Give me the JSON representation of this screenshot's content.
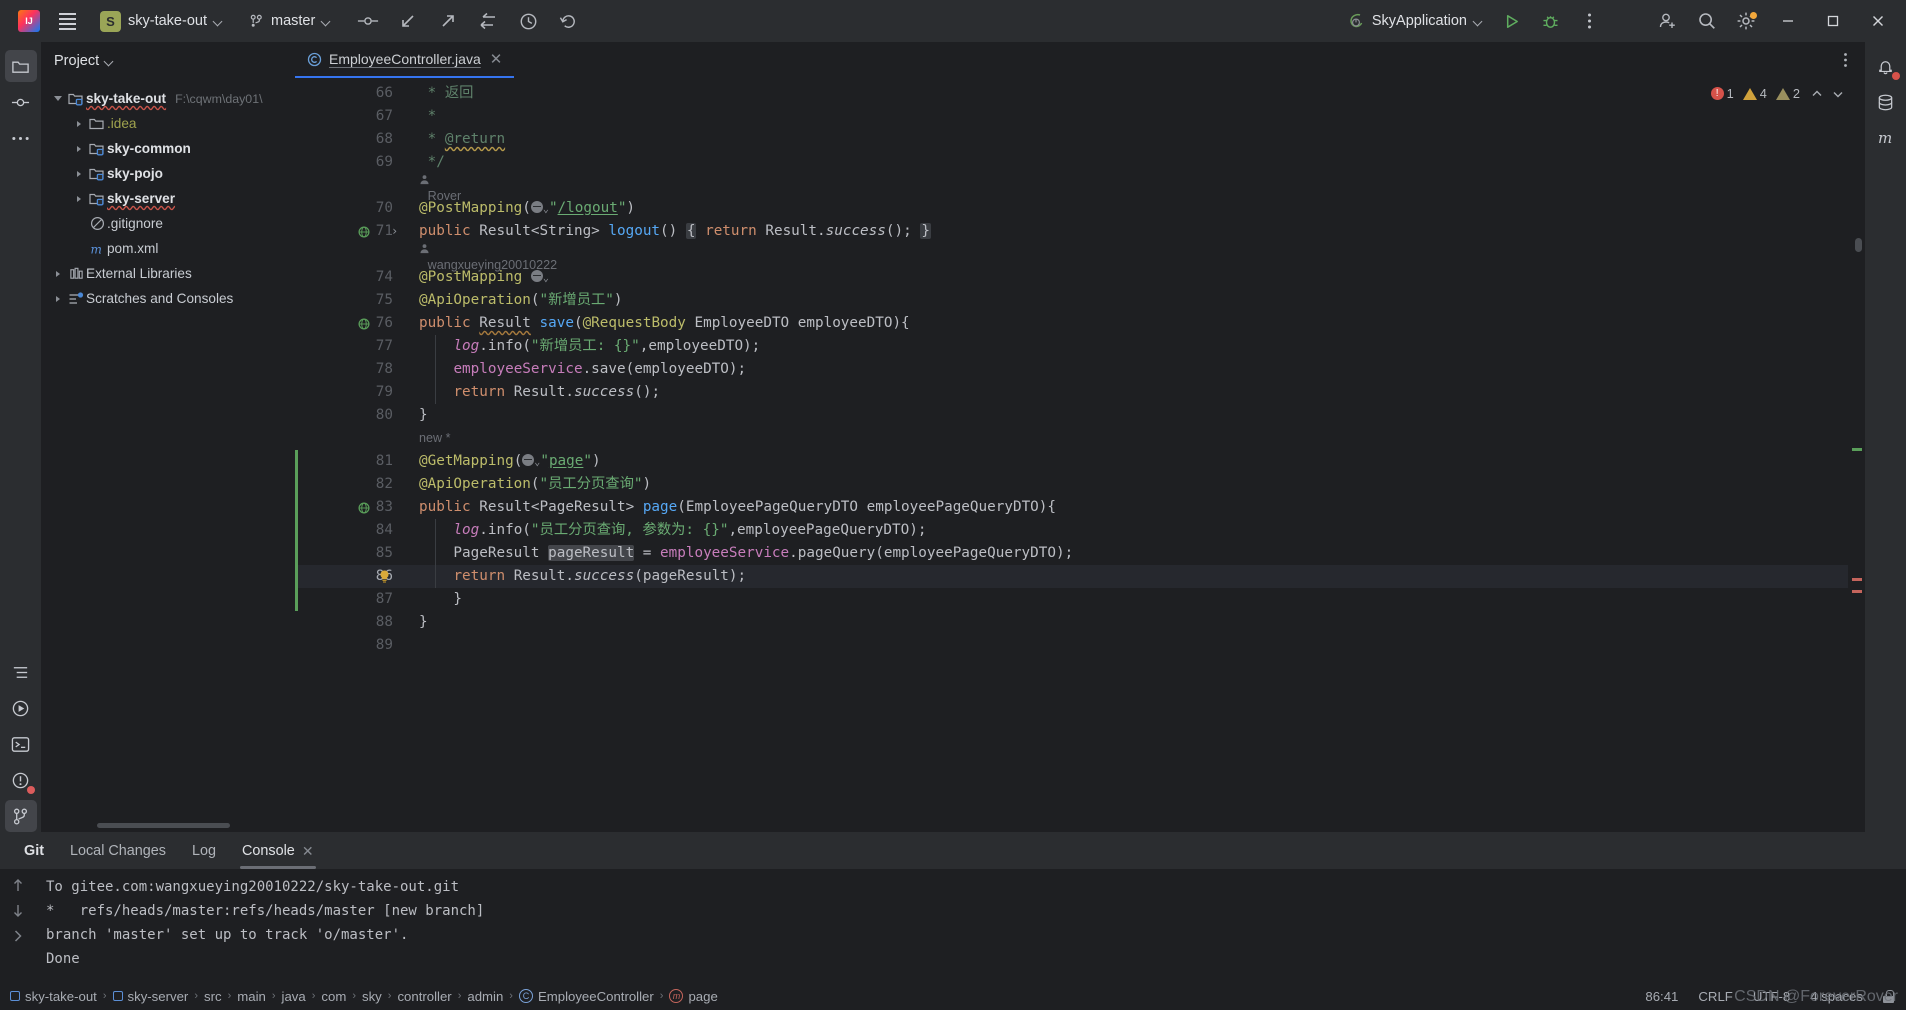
{
  "titlebar": {
    "project_name": "sky-take-out",
    "project_badge": "S",
    "branch": "master",
    "run_config": "SkyApplication",
    "icons": [
      "main-menu-icon",
      "vcs-commit-icon",
      "vcs-update-icon",
      "vcs-push-icon",
      "vcs-rollback-icon",
      "recent-files-icon",
      "undo-icon",
      "run-icon",
      "debug-icon",
      "more-actions-icon",
      "add-account-icon",
      "search-everywhere-icon",
      "settings-icon"
    ],
    "window_buttons": [
      "minimize",
      "maximize",
      "close"
    ]
  },
  "left_rail": {
    "items": [
      {
        "name": "project-tool-window",
        "icon": "folder-icon",
        "active": true
      },
      {
        "name": "commit-tool-window",
        "icon": "commit-icon",
        "active": false
      },
      {
        "name": "more-tool-windows",
        "icon": "ellipsis-icon",
        "active": false
      },
      {
        "name": "structure-tool-window",
        "icon": "structure-icon",
        "active": false
      },
      {
        "name": "services-tool-window",
        "icon": "services-icon",
        "active": false
      },
      {
        "name": "terminal-tool-window",
        "icon": "terminal-icon",
        "active": false
      },
      {
        "name": "problems-tool-window",
        "icon": "problems-icon",
        "active": false
      },
      {
        "name": "git-tool-window",
        "icon": "git-branch-icon",
        "active": true
      }
    ]
  },
  "right_rail": {
    "items": [
      {
        "name": "notifications-tool-window",
        "icon": "bell-icon"
      },
      {
        "name": "database-tool-window",
        "icon": "database-icon"
      },
      {
        "name": "maven-tool-window",
        "icon": "maven-icon"
      }
    ]
  },
  "project_panel": {
    "title": "Project",
    "tree": [
      {
        "indent": 0,
        "arrow": "open",
        "icon": "module-folder-icon",
        "label": "sky-take-out",
        "bold": true,
        "wavy": true,
        "note": "F:\\cqwm\\day01\\"
      },
      {
        "indent": 1,
        "arrow": "closed",
        "icon": "folder-icon",
        "label": ".idea",
        "bold": false,
        "olive": true
      },
      {
        "indent": 1,
        "arrow": "closed",
        "icon": "module-folder-icon",
        "label": "sky-common",
        "bold": true
      },
      {
        "indent": 1,
        "arrow": "closed",
        "icon": "module-folder-icon",
        "label": "sky-pojo",
        "bold": true
      },
      {
        "indent": 1,
        "arrow": "closed",
        "icon": "module-folder-icon",
        "label": "sky-server",
        "bold": true,
        "wavy": true
      },
      {
        "indent": 1,
        "arrow": "none",
        "icon": "gitignore-icon",
        "label": ".gitignore"
      },
      {
        "indent": 1,
        "arrow": "none",
        "icon": "maven-m-icon",
        "label": "pom.xml"
      },
      {
        "indent": 0,
        "arrow": "closed",
        "icon": "library-icon",
        "label": "External Libraries"
      },
      {
        "indent": 0,
        "arrow": "closed",
        "icon": "scratches-icon",
        "label": "Scratches and Consoles"
      }
    ]
  },
  "editor": {
    "tab": {
      "filename": "EmployeeController.java",
      "icon": "java-class-icon"
    },
    "inspections": {
      "errors": "1",
      "warnings": "4",
      "weak_warnings": "2"
    },
    "lines": [
      {
        "num": "66",
        "segments": [
          {
            "t": " * ",
            "c": "cmt"
          },
          {
            "t": "返回",
            "c": "cmt"
          }
        ]
      },
      {
        "num": "67",
        "segments": [
          {
            "t": " *",
            "c": "cmt"
          }
        ]
      },
      {
        "num": "68",
        "segments": [
          {
            "t": " * ",
            "c": "cmt"
          },
          {
            "t": "@return",
            "c": "cmt wavy-y"
          }
        ]
      },
      {
        "num": "69",
        "segments": [
          {
            "t": " */",
            "c": "cmt"
          }
        ]
      },
      {
        "num": "",
        "inlay": "Rover",
        "inlay_icon": "author-icon"
      },
      {
        "num": "70",
        "segments": [
          {
            "t": "@PostMapping",
            "c": "ann"
          },
          {
            "t": "(",
            "c": "pun"
          },
          {
            "t": "GLOBE"
          },
          {
            "t": "\"",
            "c": "str"
          },
          {
            "t": "/logout",
            "c": "str und"
          },
          {
            "t": "\"",
            "c": "str"
          },
          {
            "t": ")",
            "c": "pun"
          }
        ]
      },
      {
        "num": "71",
        "gutter_icon": "web-method-icon",
        "fold": true,
        "segments": [
          {
            "t": "public ",
            "c": "kw"
          },
          {
            "t": "Result",
            "c": "typ"
          },
          {
            "t": "<String> ",
            "c": "pun"
          },
          {
            "t": "logout",
            "c": "mth"
          },
          {
            "t": "() ",
            "c": "pun"
          },
          {
            "t": "{",
            "c": "folded-brace"
          },
          {
            "t": " ",
            "c": "pun"
          },
          {
            "t": "return ",
            "c": "kw"
          },
          {
            "t": "Result.",
            "c": "typ"
          },
          {
            "t": "success",
            "c": "stat"
          },
          {
            "t": "(); ",
            "c": "pun"
          },
          {
            "t": "}",
            "c": "folded-brace"
          }
        ]
      },
      {
        "num": "",
        "inlay": "wangxueying20010222",
        "inlay_icon": "author-icon"
      },
      {
        "num": "74",
        "segments": [
          {
            "t": "@PostMapping",
            "c": "ann"
          },
          {
            "t": " ",
            "c": "pun"
          },
          {
            "t": "GLOBE"
          }
        ]
      },
      {
        "num": "75",
        "segments": [
          {
            "t": "@ApiOperation",
            "c": "ann"
          },
          {
            "t": "(",
            "c": "pun"
          },
          {
            "t": "\"新增员工\"",
            "c": "str"
          },
          {
            "t": ")",
            "c": "pun"
          }
        ]
      },
      {
        "num": "76",
        "gutter_icon": "web-method-icon",
        "segments": [
          {
            "t": "public ",
            "c": "kw"
          },
          {
            "t": "Result",
            "c": "typ wavy-o"
          },
          {
            "t": " ",
            "c": "pun"
          },
          {
            "t": "save",
            "c": "mth"
          },
          {
            "t": "(",
            "c": "pun"
          },
          {
            "t": "@RequestBody",
            "c": "ann"
          },
          {
            "t": " EmployeeDTO employeeDTO){",
            "c": "pun"
          }
        ]
      },
      {
        "num": "77",
        "indent_guide": true,
        "segments": [
          {
            "t": "    ",
            "c": "pun"
          },
          {
            "t": "log",
            "c": "logv"
          },
          {
            "t": ".",
            "c": "pun"
          },
          {
            "t": "info",
            "c": "pun"
          },
          {
            "t": "(",
            "c": "pun"
          },
          {
            "t": "\"新增员工: {}\"",
            "c": "str"
          },
          {
            "t": ",employeeDTO);",
            "c": "pun"
          }
        ]
      },
      {
        "num": "78",
        "indent_guide": true,
        "segments": [
          {
            "t": "    ",
            "c": "pun"
          },
          {
            "t": "employeeService",
            "c": "fld"
          },
          {
            "t": ".save(employeeDTO);",
            "c": "pun"
          }
        ]
      },
      {
        "num": "79",
        "indent_guide": true,
        "segments": [
          {
            "t": "    ",
            "c": "pun"
          },
          {
            "t": "return ",
            "c": "kw"
          },
          {
            "t": "Result.",
            "c": "typ"
          },
          {
            "t": "success",
            "c": "stat"
          },
          {
            "t": "();",
            "c": "pun"
          }
        ]
      },
      {
        "num": "80",
        "segments": [
          {
            "t": "}",
            "c": "pun"
          }
        ]
      },
      {
        "num": "",
        "inlay": "new *"
      },
      {
        "num": "81",
        "changed": true,
        "segments": [
          {
            "t": "@GetMapping",
            "c": "ann"
          },
          {
            "t": "(",
            "c": "pun"
          },
          {
            "t": "GLOBE"
          },
          {
            "t": "\"",
            "c": "str"
          },
          {
            "t": "page",
            "c": "str und"
          },
          {
            "t": "\"",
            "c": "str"
          },
          {
            "t": ")",
            "c": "pun"
          }
        ]
      },
      {
        "num": "82",
        "changed": true,
        "segments": [
          {
            "t": "@ApiOperation",
            "c": "ann"
          },
          {
            "t": "(",
            "c": "pun"
          },
          {
            "t": "\"员工分页查询\"",
            "c": "str"
          },
          {
            "t": ")",
            "c": "pun"
          }
        ]
      },
      {
        "num": "83",
        "changed": true,
        "gutter_icon": "web-method-icon",
        "segments": [
          {
            "t": "public ",
            "c": "kw"
          },
          {
            "t": "Result",
            "c": "typ"
          },
          {
            "t": "<PageResult> ",
            "c": "pun"
          },
          {
            "t": "page",
            "c": "mth"
          },
          {
            "t": "(EmployeePageQueryDTO employeePageQueryDTO){",
            "c": "pun"
          }
        ]
      },
      {
        "num": "84",
        "changed": true,
        "indent_guide": true,
        "segments": [
          {
            "t": "    ",
            "c": "pun"
          },
          {
            "t": "log",
            "c": "logv"
          },
          {
            "t": ".info(",
            "c": "pun"
          },
          {
            "t": "\"员工分页查询, 参数为: {}\"",
            "c": "str"
          },
          {
            "t": ",employeePageQueryDTO);",
            "c": "pun"
          }
        ]
      },
      {
        "num": "85",
        "changed": true,
        "indent_guide": true,
        "segments": [
          {
            "t": "    PageResult ",
            "c": "pun"
          },
          {
            "t": "pageResult",
            "c": "pun sel-hl"
          },
          {
            "t": " = ",
            "c": "pun"
          },
          {
            "t": "employeeService",
            "c": "fld"
          },
          {
            "t": ".pageQuery(employeePageQueryDTO);",
            "c": "pun"
          }
        ]
      },
      {
        "num": "86",
        "changed": true,
        "current": true,
        "indent_guide": true,
        "gutter_icon": "intention-bulb-icon",
        "segments": [
          {
            "t": "    ",
            "c": "pun"
          },
          {
            "t": "return ",
            "c": "kw"
          },
          {
            "t": "Result.",
            "c": "typ"
          },
          {
            "t": "success",
            "c": "stat"
          },
          {
            "t": "(pageResult);",
            "c": "pun"
          }
        ]
      },
      {
        "num": "87",
        "changed": true,
        "segments": [
          {
            "t": "    }",
            "c": "pun"
          }
        ]
      },
      {
        "num": "88",
        "segments": [
          {
            "t": "}",
            "c": "pun"
          }
        ]
      },
      {
        "num": "89",
        "segments": []
      }
    ]
  },
  "bottom_panel": {
    "tabs": [
      {
        "label": "Git",
        "bold": true,
        "active": false,
        "closable": false
      },
      {
        "label": "Local Changes",
        "bold": false,
        "active": false,
        "closable": false
      },
      {
        "label": "Log",
        "bold": false,
        "active": false,
        "closable": false
      },
      {
        "label": "Console",
        "bold": false,
        "active": true,
        "closable": true
      }
    ],
    "console_lines": [
      "To gitee.com:wangxueying20010222/sky-take-out.git",
      "*   refs/heads/master:refs/heads/master [new branch]",
      "branch 'master' set up to track 'o/master'.",
      "Done"
    ]
  },
  "status_bar": {
    "breadcrumbs": [
      {
        "label": "sky-take-out",
        "icon": "module-square-icon"
      },
      {
        "label": "sky-server",
        "icon": "module-square-icon"
      },
      {
        "label": "src",
        "icon": "none"
      },
      {
        "label": "main",
        "icon": "none"
      },
      {
        "label": "java",
        "icon": "none"
      },
      {
        "label": "com",
        "icon": "none"
      },
      {
        "label": "sky",
        "icon": "none"
      },
      {
        "label": "controller",
        "icon": "none"
      },
      {
        "label": "admin",
        "icon": "none"
      },
      {
        "label": "EmployeeController",
        "icon": "class-circle-icon"
      },
      {
        "label": "page",
        "icon": "method-circle-icon"
      }
    ],
    "caret_position": "86:41",
    "line_separator": "CRLF",
    "encoding": "UTF-8",
    "indent": "4 spaces",
    "lock_icon": "read-only-lock-icon",
    "watermark": "CSDN @ForeverRover"
  },
  "colors": {
    "accent_blue": "#3574f0",
    "keyword": "#cf8e6d",
    "string": "#6aab73",
    "annotation": "#bcbc6a",
    "error_red": "#d6524a",
    "warning_yellow": "#d1a23c",
    "change_green": "#5a9e5a"
  }
}
